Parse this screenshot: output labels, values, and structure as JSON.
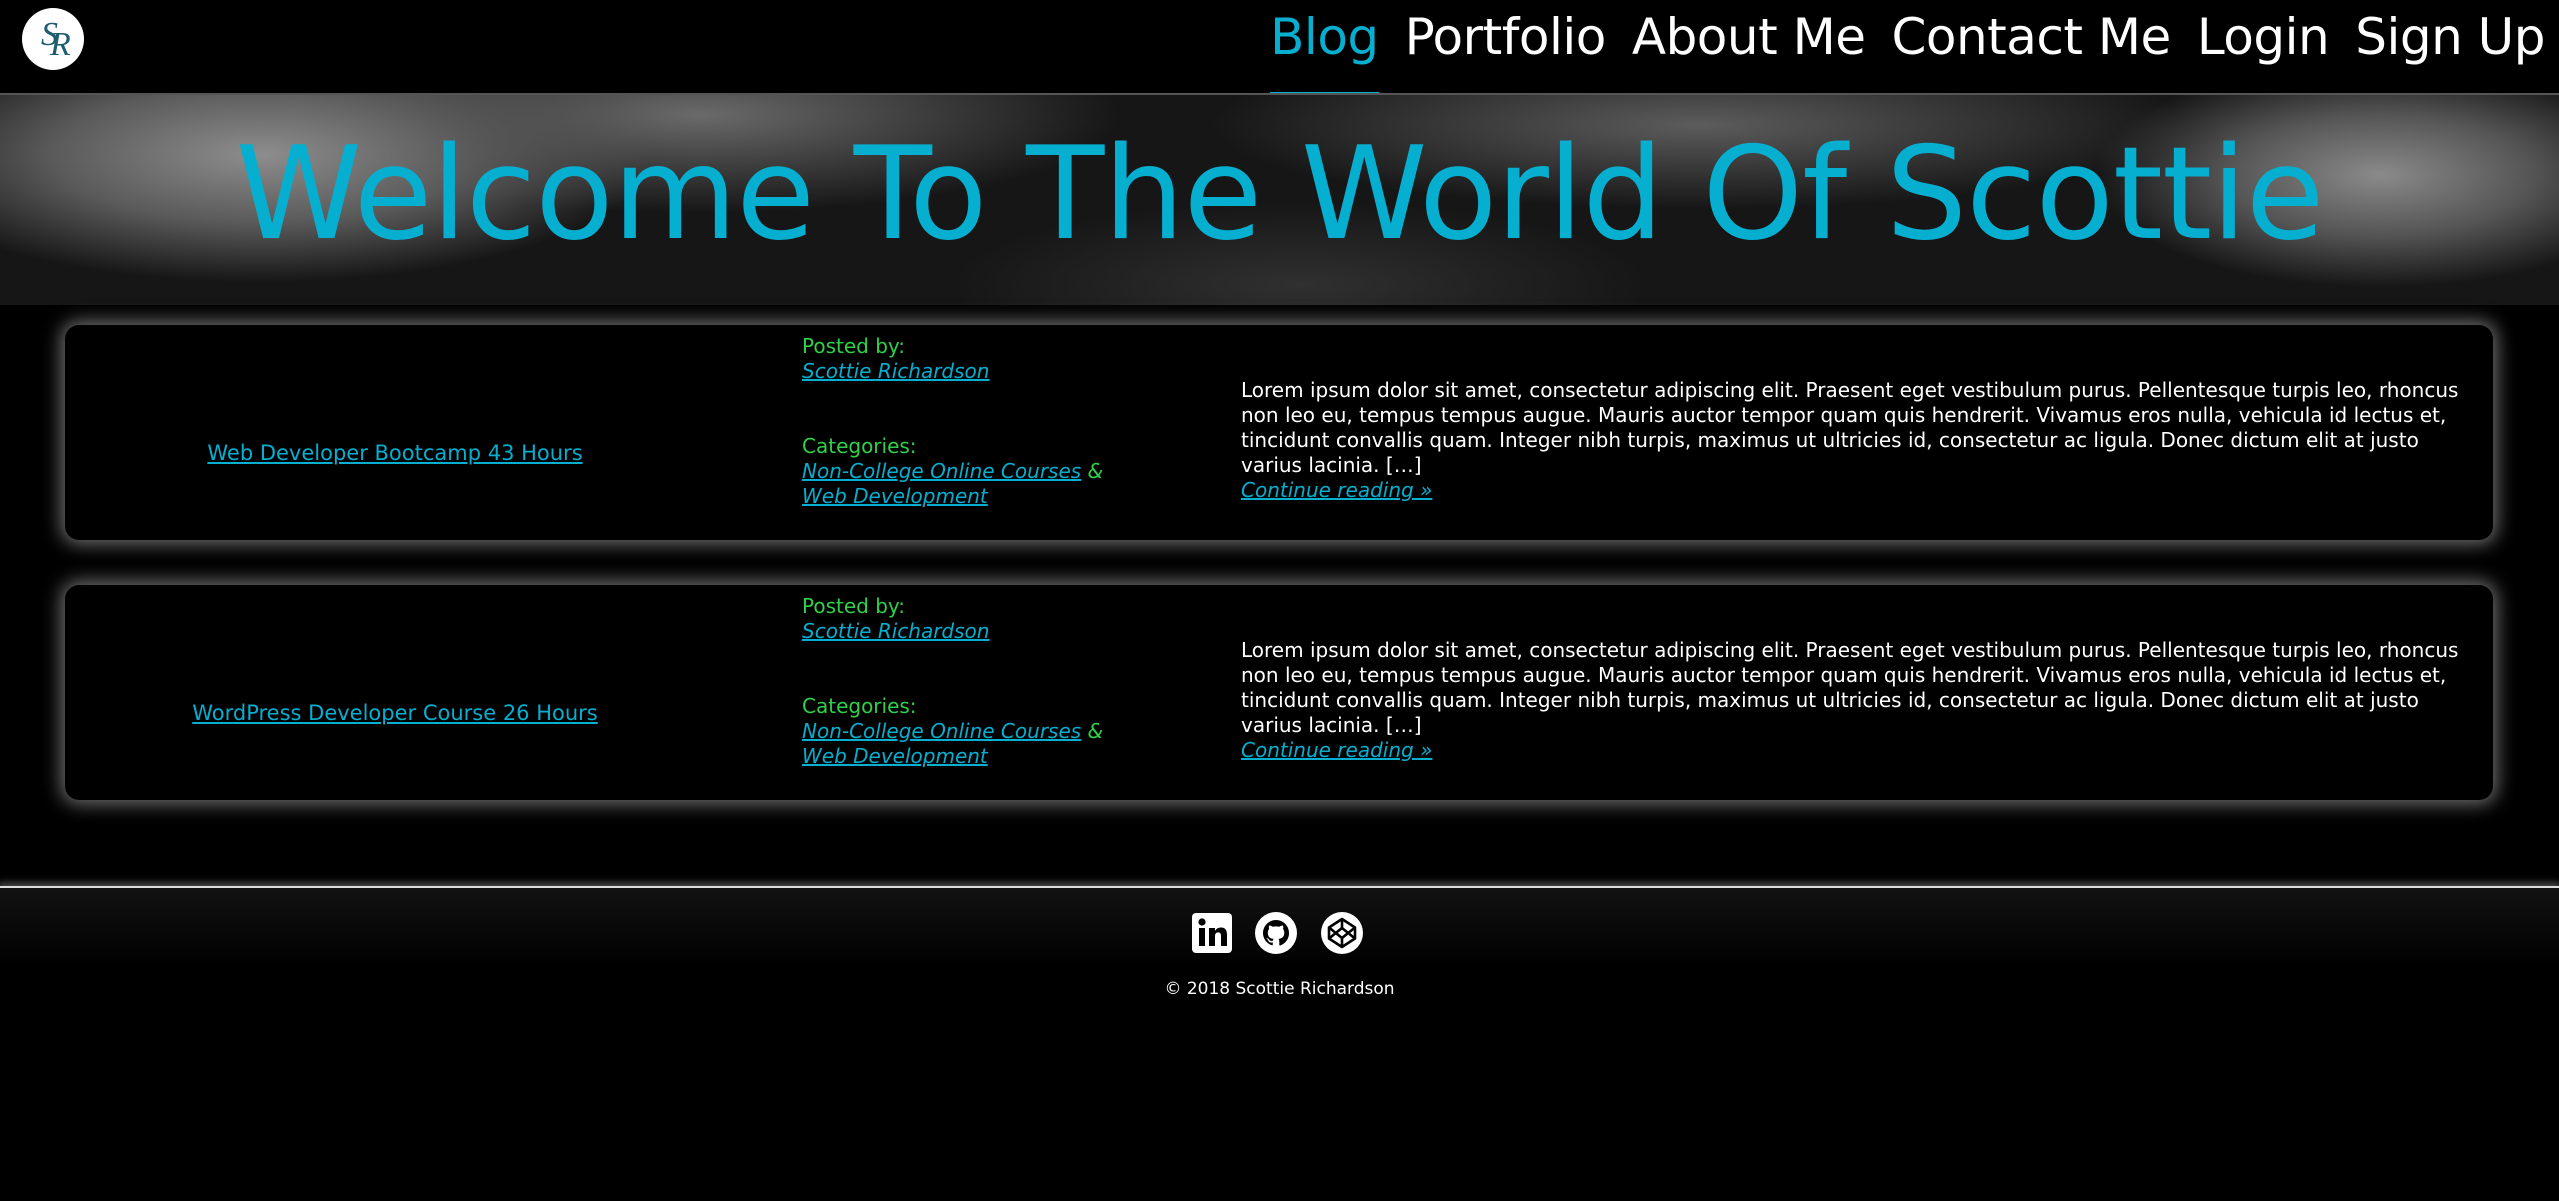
{
  "header": {
    "logo_text": "SR",
    "nav": [
      {
        "label": "Blog",
        "active": true
      },
      {
        "label": "Portfolio",
        "active": false
      },
      {
        "label": "About Me",
        "active": false
      },
      {
        "label": "Contact Me",
        "active": false
      },
      {
        "label": "Login",
        "active": false
      },
      {
        "label": "Sign Up",
        "active": false
      }
    ]
  },
  "hero": {
    "title": "Welcome To The World Of Scottie"
  },
  "posts": [
    {
      "title": "Web Developer Bootcamp 43 Hours",
      "posted_by_label": "Posted by:",
      "author": "Scottie Richardson",
      "categories_label": "Categories:",
      "categories": [
        "Non-College Online Courses",
        "Web Development"
      ],
      "category_separator": "&",
      "excerpt": "Lorem ipsum dolor sit amet, consectetur adipiscing elit. Praesent eget vestibulum purus. Pellentesque turpis leo, rhoncus non leo eu, tempus tempus augue. Mauris auctor tempor quam quis hendrerit. Vivamus eros nulla, vehicula id lectus et, tincidunt convallis quam. Integer nibh turpis, maximus ut ultricies id, consectetur ac ligula. Donec dictum elit at justo varius lacinia. […]",
      "read_more": "Continue reading »"
    },
    {
      "title": "WordPress Developer Course 26 Hours",
      "posted_by_label": "Posted by:",
      "author": "Scottie Richardson",
      "categories_label": "Categories:",
      "categories": [
        "Non-College Online Courses",
        "Web Development"
      ],
      "category_separator": "&",
      "excerpt": "Lorem ipsum dolor sit amet, consectetur adipiscing elit. Praesent eget vestibulum purus. Pellentesque turpis leo, rhoncus non leo eu, tempus tempus augue. Mauris auctor tempor quam quis hendrerit. Vivamus eros nulla, vehicula id lectus et, tincidunt convallis quam. Integer nibh turpis, maximus ut ultricies id, consectetur ac ligula. Donec dictum elit at justo varius lacinia. […]",
      "read_more": "Continue reading »"
    }
  ],
  "footer": {
    "social": [
      {
        "icon": "linkedin-icon"
      },
      {
        "icon": "github-icon"
      },
      {
        "icon": "codepen-icon"
      }
    ],
    "copyright": "© 2018 Scottie Richardson"
  },
  "colors": {
    "accent": "#06aecf",
    "label_green": "#2ed14a",
    "background": "#000000",
    "text": "#ffffff"
  }
}
